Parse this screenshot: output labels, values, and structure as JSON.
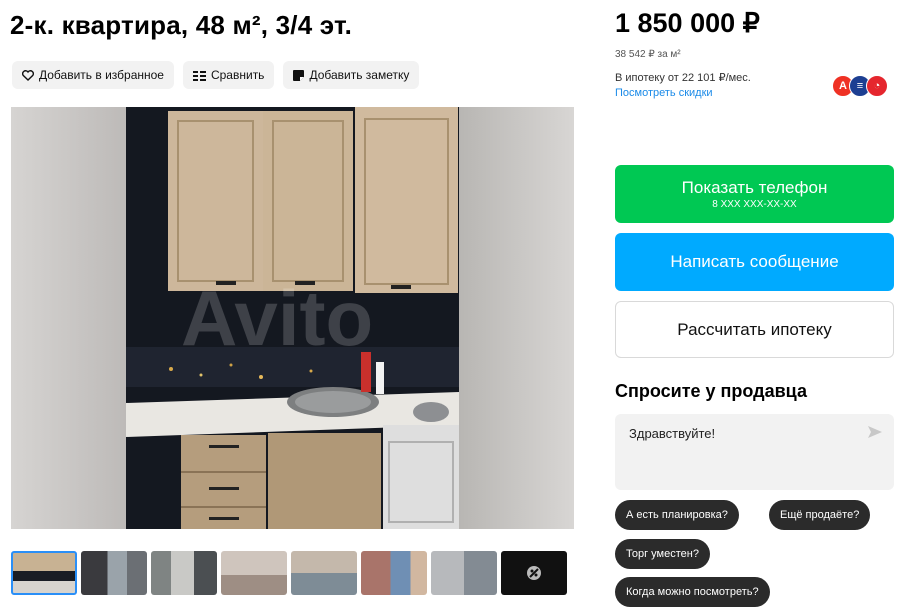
{
  "listing": {
    "title": "2-к. квартира, 48 м², 3/4 эт."
  },
  "actions": {
    "favorite": "Добавить в избранное",
    "compare": "Сравнить",
    "note": "Добавить заметку"
  },
  "gallery": {
    "watermark": "Avito",
    "thumbnails": 8,
    "active_index": 0
  },
  "price": {
    "value": "1 850 000 ₽",
    "per_m2": "38 542 ₽ за м²",
    "mortgage": "В ипотеку от 22 101 ₽/мес.",
    "discounts_link": "Посмотреть скидки"
  },
  "buttons": {
    "show_phone": "Показать телефон",
    "phone_mask": "8 XXX XXX-XX-XX",
    "write_message": "Написать сообщение",
    "calc_mortgage": "Рассчитать ипотеку"
  },
  "ask": {
    "title": "Спросите у продавца",
    "input_value": "Здравствуйте!",
    "chips": [
      "А есть планировка?",
      "Ещё продаёте?",
      "Торг уместен?",
      "Когда можно посмотреть?"
    ]
  },
  "colors": {
    "green": "#00c853",
    "blue": "#00aaff",
    "link": "#1a8ae8",
    "chip": "#2b2b2b"
  }
}
